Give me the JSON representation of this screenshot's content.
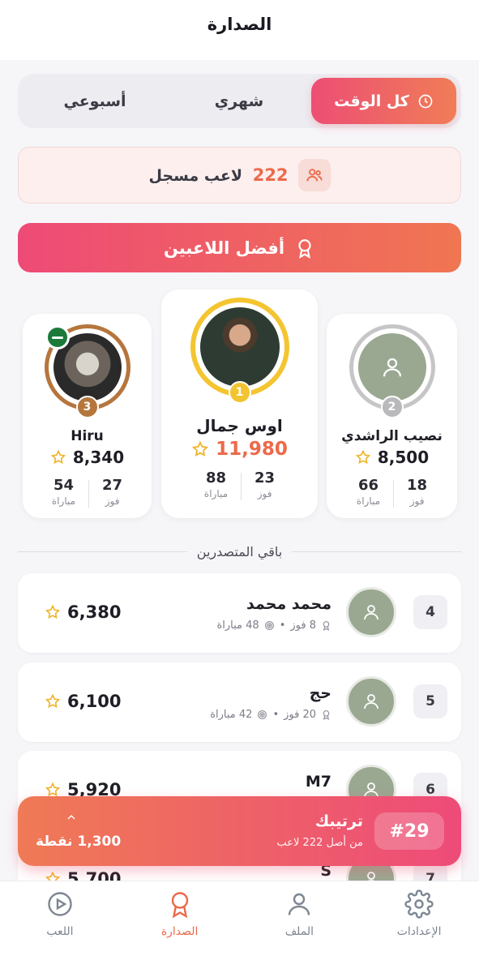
{
  "header": {
    "title": "الصدارة"
  },
  "tabs": [
    {
      "label": "كل الوقت",
      "icon": "clock-icon",
      "active": true
    },
    {
      "label": "شهري",
      "active": false
    },
    {
      "label": "أسبوعي",
      "active": false
    }
  ],
  "registered": {
    "count": "222",
    "label": "لاعب مسجل",
    "icon": "users-icon"
  },
  "best_banner": {
    "label": "أفضل اللاعبين",
    "icon": "medal-icon"
  },
  "podium": [
    {
      "rank": "2",
      "name": "نصيب الراشدي",
      "score": "8,500",
      "wins": "18",
      "wins_label": "فوز",
      "matches": "66",
      "matches_label": "مباراة"
    },
    {
      "rank": "1",
      "name": "اوس جمال",
      "score": "11,980",
      "wins": "23",
      "wins_label": "فوز",
      "matches": "88",
      "matches_label": "مباراة"
    },
    {
      "rank": "3",
      "name": "Hiru",
      "score": "8,340",
      "wins": "27",
      "wins_label": "فوز",
      "matches": "54",
      "matches_label": "مباراة"
    }
  ],
  "others_title": "باقي المتصدرين",
  "rows": [
    {
      "rank": "4",
      "name": "محمد محمد",
      "wins": "8 فوز",
      "matches": "48 مباراة",
      "score": "6,380"
    },
    {
      "rank": "5",
      "name": "حج",
      "wins": "20 فوز",
      "matches": "42 مباراة",
      "score": "6,100"
    },
    {
      "rank": "6",
      "name": "M7",
      "score": "5,920"
    },
    {
      "rank": "7",
      "name": "S",
      "score": "5,700"
    }
  ],
  "my_rank": {
    "badge": "#29",
    "title": "ترتيبك",
    "subtitle": "من أصل 222 لاعب",
    "points": "1,300 نقطة"
  },
  "nav": [
    {
      "label": "الإعدادات",
      "icon": "gear-icon",
      "active": false
    },
    {
      "label": "الملف",
      "icon": "user-icon",
      "active": false
    },
    {
      "label": "الصدارة",
      "icon": "medal-icon",
      "active": true
    },
    {
      "label": "اللعب",
      "icon": "play-icon",
      "active": false
    }
  ],
  "colors": {
    "accent": "#ec6a4a",
    "gradient_start": "#ee4a76",
    "gradient_end": "#f07652",
    "gold": "#f2c430",
    "silver": "#b9b9bc",
    "bronze": "#b5763d"
  }
}
